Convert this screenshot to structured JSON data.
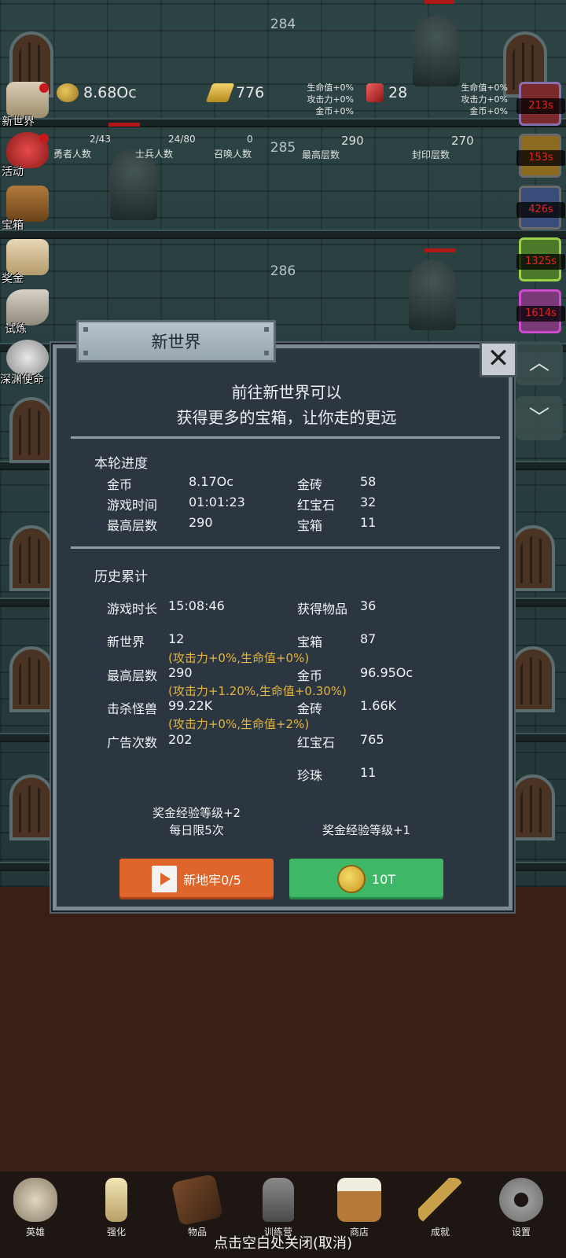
{
  "floors": [
    "284",
    "285",
    "286"
  ],
  "hud": {
    "coins": "8.68Oc",
    "gold_bricks": "776",
    "rubies": "28",
    "bonus_left": [
      "生命值+0%",
      "攻击力+0%",
      "金币+0%"
    ],
    "bonus_right": [
      "生命值+0%",
      "攻击力+0%",
      "金币+0%"
    ]
  },
  "stats": {
    "heroes": {
      "value": "2/43",
      "label": "勇者人数"
    },
    "soldiers": {
      "value": "24/80",
      "label": "士兵人数"
    },
    "summons": {
      "value": "0",
      "label": "召唤人数"
    },
    "max_floor": {
      "value": "290",
      "label": "最高层数"
    },
    "sealed_floor": {
      "value": "270",
      "label": "封印层数"
    }
  },
  "side_menu": [
    "新世界",
    "活动",
    "宝箱",
    "奖金",
    "试炼",
    "深渊使命"
  ],
  "boost_timers": [
    "213s",
    "153s",
    "426s",
    "1325s",
    "1614s"
  ],
  "colors": {
    "orange": "#e0652a",
    "green": "#3eb867",
    "note_gold": "#e4b53e"
  },
  "dialog": {
    "title": "新世界",
    "intro_line1": "前往新世界可以",
    "intro_line2": "获得更多的宝箱，让你走的更远",
    "round_title": "本轮进度",
    "round": {
      "coins_label": "金币",
      "coins": "8.17Oc",
      "bricks_label": "金砖",
      "bricks": "58",
      "time_label": "游戏时间",
      "time": "01:01:23",
      "ruby_label": "红宝石",
      "ruby": "32",
      "floor_label": "最高层数",
      "floor": "290",
      "chest_label": "宝箱",
      "chest": "11"
    },
    "history_title": "历史累计",
    "history": {
      "playtime_label": "游戏时长",
      "playtime": "15:08:46",
      "items_label": "获得物品",
      "items": "36",
      "newworld_label": "新世界",
      "newworld": "12",
      "chest_label": "宝箱",
      "chest": "87",
      "note1": "(攻击力+0%,生命值+0%)",
      "maxfloor_label": "最高层数",
      "maxfloor": "290",
      "coins_label": "金币",
      "coins": "96.95Oc",
      "note2": "(攻击力+1.20%,生命值+0.30%)",
      "kills_label": "击杀怪兽",
      "kills": "99.22K",
      "bricks_label": "金砖",
      "bricks": "1.66K",
      "note3": "(攻击力+0%,生命值+2%)",
      "ads_label": "广告次数",
      "ads": "202",
      "ruby_label": "红宝石",
      "ruby": "765",
      "pearl_label": "珍珠",
      "pearl": "11"
    },
    "left_caption1": "奖金经验等级+2",
    "left_caption2": "每日限5次",
    "right_caption": "奖金经验等级+1",
    "left_button": "新地牢0/5",
    "right_button": "10T"
  },
  "bottom_nav": [
    "英雄",
    "强化",
    "物品",
    "训练营",
    "商店",
    "成就",
    "设置"
  ],
  "hint": "点击空白处关闭(取消)"
}
